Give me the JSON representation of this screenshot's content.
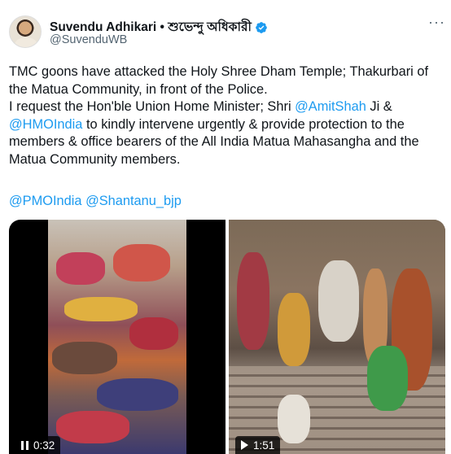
{
  "author": {
    "display_name": "Suvendu Adhikari • শুভেন্দু অধিকারী",
    "handle": "@SuvenduWB",
    "verified_icon": "verified-badge-icon"
  },
  "more_icon": "more-options-icon",
  "tweet": {
    "line1": "TMC goons have attacked the Holy Shree Dham Temple; Thakurbari of",
    "line2": "the Matua Community, in front of the Police.",
    "line3_pre": "I request the Hon'ble Union Home Minister; Shri ",
    "line3_mention": "@AmitShah",
    "line3_post": " Ji &",
    "line4_mention": "@HMOIndia",
    "line4_post": " to kindly intervene urgently & provide protection to the",
    "line5": "members & office bearers of the All India Matua Mahasangha and the",
    "line6": "Matua Community members.",
    "mentions": "@PMOIndia @Shantanu_bjp"
  },
  "media": {
    "video1": {
      "duration": "0:32",
      "control_icon": "pause-icon"
    },
    "video2": {
      "duration": "1:51",
      "control_icon": "play-icon"
    }
  },
  "colors": {
    "link": "#1d9bf0",
    "verified": "#1d9bf0",
    "text": "#0f1419",
    "secondary": "#536471"
  }
}
